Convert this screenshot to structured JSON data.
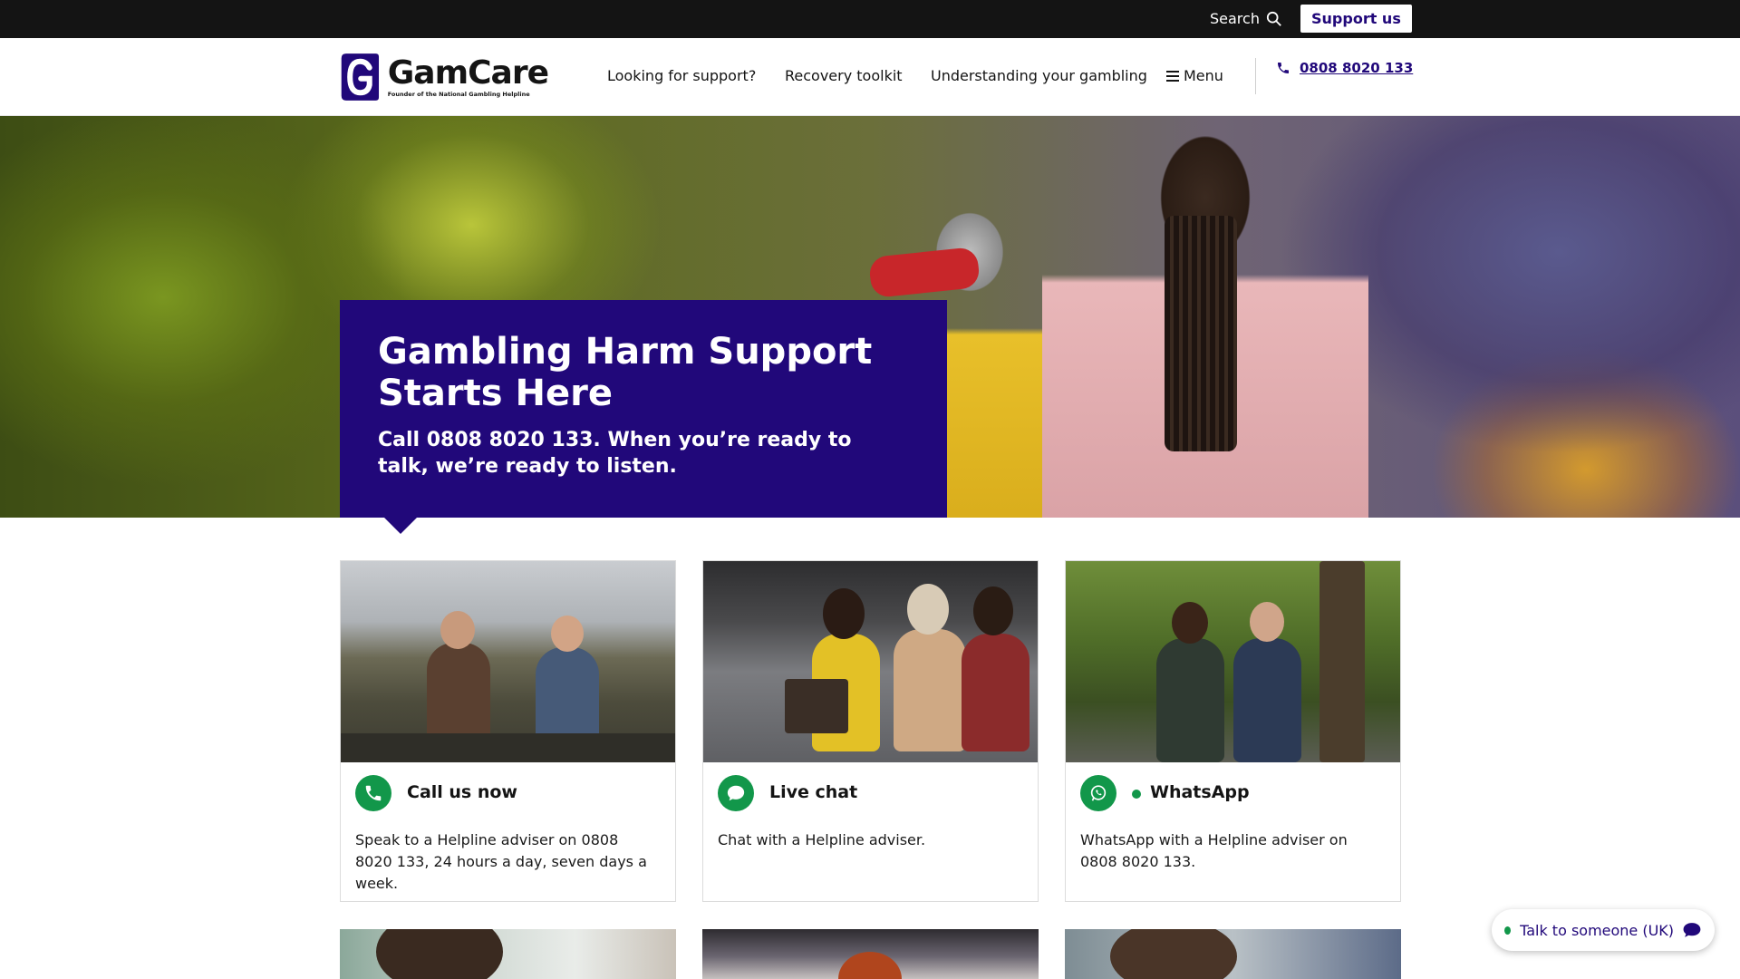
{
  "utility_bar": {
    "search_label": "Search",
    "support_label": "Support us"
  },
  "header": {
    "logo_name": "GamCare",
    "logo_tagline": "Founder of the National Gambling Helpline",
    "nav": [
      {
        "label": "Looking for support?"
      },
      {
        "label": "Recovery toolkit"
      },
      {
        "label": "Understanding your gambling"
      }
    ],
    "menu_label": "Menu",
    "phone": "0808 8020 133"
  },
  "hero": {
    "title_line1": "Gambling Harm Support",
    "title_line2": "Starts Here",
    "subtitle": "Call 0808 8020 133. When you’re ready to talk, we’re ready to listen."
  },
  "cards": [
    {
      "title": "Call us now",
      "text": "Speak to a Helpline adviser on 0808 8020 133, 24 hours a day, seven days a week.",
      "icon": "phone-icon"
    },
    {
      "title": "Live chat",
      "text": "Chat with a Helpline adviser.",
      "icon": "chat-bubble-icon"
    },
    {
      "title": "WhatsApp",
      "text": "WhatsApp with a Helpline adviser on 0808 8020 133.",
      "icon": "whatsapp-icon"
    }
  ],
  "chat_widget": {
    "label": "Talk to someone (UK)"
  },
  "colors": {
    "brand_purple": "#21087a",
    "accent_green": "#12974a",
    "utility_bar": "#141414"
  }
}
